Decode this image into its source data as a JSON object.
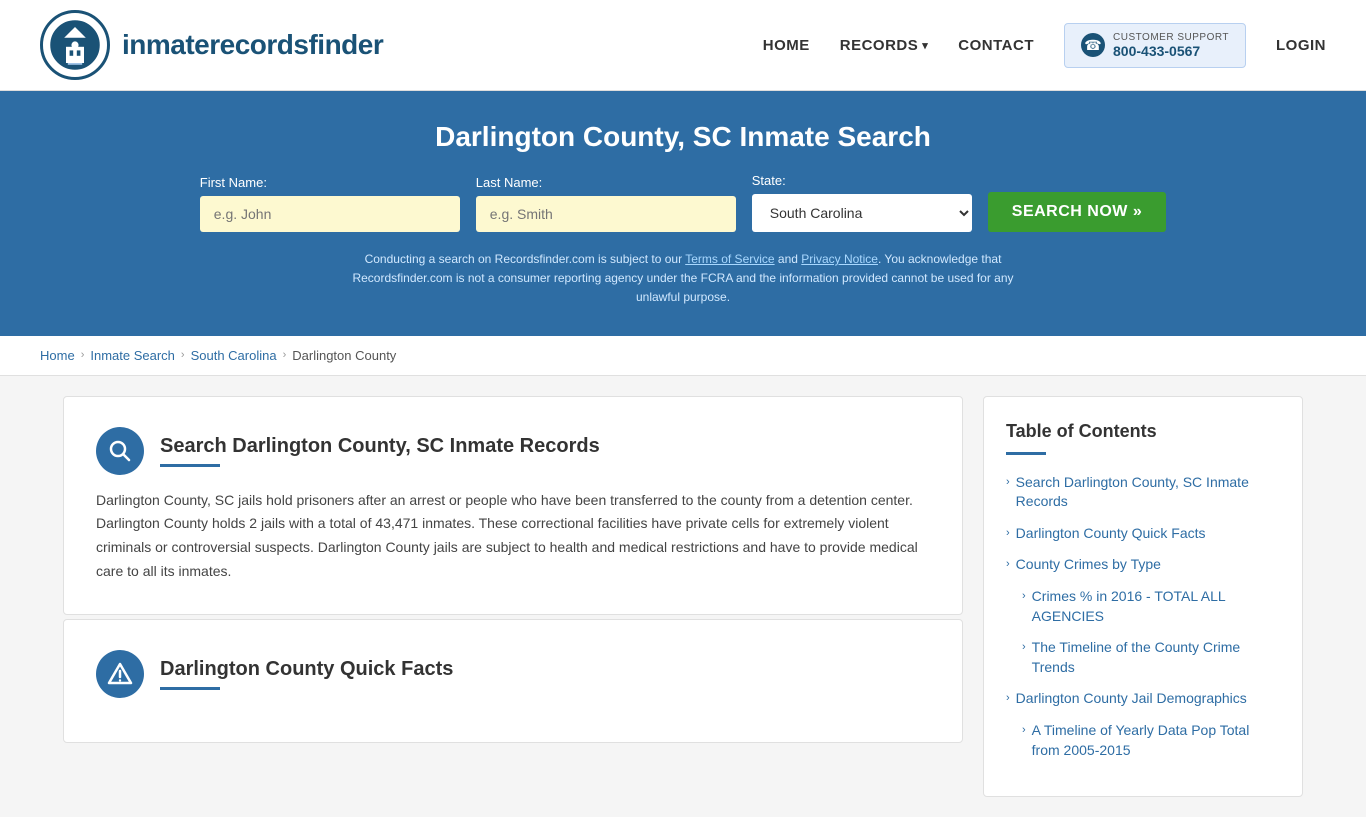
{
  "site": {
    "logo_text_light": "inmaterecords",
    "logo_text_bold": "finder"
  },
  "nav": {
    "home": "HOME",
    "records": "RECORDS",
    "contact": "CONTACT",
    "login": "LOGIN",
    "support_label": "CUSTOMER SUPPORT",
    "support_number": "800-433-0567"
  },
  "hero": {
    "title": "Darlington County, SC Inmate Search",
    "first_name_label": "First Name:",
    "first_name_placeholder": "e.g. John",
    "last_name_label": "Last Name:",
    "last_name_placeholder": "e.g. Smith",
    "state_label": "State:",
    "state_value": "South Carolina",
    "search_button": "SEARCH NOW »",
    "disclaimer": "Conducting a search on Recordsfinder.com is subject to our Terms of Service and Privacy Notice. You acknowledge that Recordsfinder.com is not a consumer reporting agency under the FCRA and the information provided cannot be used for any unlawful purpose.",
    "tos_label": "Terms of Service",
    "privacy_label": "Privacy Notice"
  },
  "breadcrumb": {
    "home": "Home",
    "inmate_search": "Inmate Search",
    "south_carolina": "South Carolina",
    "current": "Darlington County"
  },
  "sections": {
    "section1": {
      "title": "Search Darlington County, SC Inmate Records",
      "body": "Darlington County, SC jails hold prisoners after an arrest or people who have been transferred to the county from a detention center. Darlington County holds 2 jails with a total of 43,471 inmates. These correctional facilities have private cells for extremely violent criminals or controversial suspects. Darlington County jails are subject to health and medical restrictions and have to provide medical care to all its inmates."
    },
    "section2": {
      "title": "Darlington County Quick Facts"
    }
  },
  "toc": {
    "title": "Table of Contents",
    "items": [
      {
        "label": "Search Darlington County, SC Inmate Records",
        "indent": false
      },
      {
        "label": "Darlington County Quick Facts",
        "indent": false
      },
      {
        "label": "County Crimes by Type",
        "indent": false
      },
      {
        "label": "Crimes % in 2016 - TOTAL ALL AGENCIES",
        "indent": true
      },
      {
        "label": "The Timeline of the County Crime Trends",
        "indent": true
      },
      {
        "label": "Darlington County Jail Demographics",
        "indent": false
      },
      {
        "label": "A Timeline of Yearly Data Pop Total from 2005-2015",
        "indent": true
      }
    ]
  }
}
